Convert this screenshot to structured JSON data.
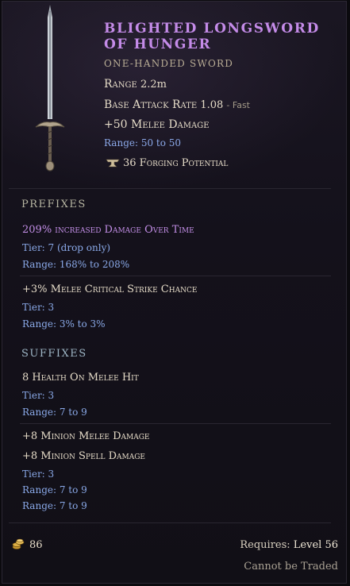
{
  "item": {
    "name": "Blighted Longsword of Hunger",
    "type": "One-Handed Sword",
    "range_label": "Range",
    "range_value": "2.2m",
    "attack_rate_label": "Base Attack Rate",
    "attack_rate_value": "1.08",
    "attack_rate_speed": "- Fast",
    "implicit": "+50 Melee Damage",
    "implicit_range": "Range: 50 to 50",
    "forging": "36 Forging Potential"
  },
  "prefixes": {
    "title": "Prefixes",
    "affixes": [
      {
        "text": "209% increased Damage Over Time",
        "tier": "Tier: 7 (drop only)",
        "range": "Range: 168% to 208%"
      },
      {
        "text": "+3% Melee Critical Strike Chance",
        "tier": "Tier: 3",
        "range": "Range: 3% to 3%"
      }
    ]
  },
  "suffixes": {
    "title": "Suffixes",
    "affixes": [
      {
        "text": "8 Health On Melee Hit",
        "tier": "Tier: 3",
        "range": "Range: 7 to 9"
      },
      {
        "text": "+8 Minion Melee Damage",
        "text2": "+8 Minion Spell Damage",
        "tier": "Tier: 3",
        "range": "Range: 7 to 9",
        "range2": "Range: 7 to 9"
      }
    ]
  },
  "footer": {
    "gold": "86",
    "requires_label": "Requires:",
    "requires_value": "Level 56",
    "trade": "Cannot be Traded"
  },
  "icons": {
    "sword": "longsword-icon",
    "forge": "anvil-icon",
    "gold": "gold-coins-icon"
  },
  "colors": {
    "title": "#c48be8",
    "range_blue": "#8ba8e8",
    "unique_purple": "#c28ee6"
  }
}
